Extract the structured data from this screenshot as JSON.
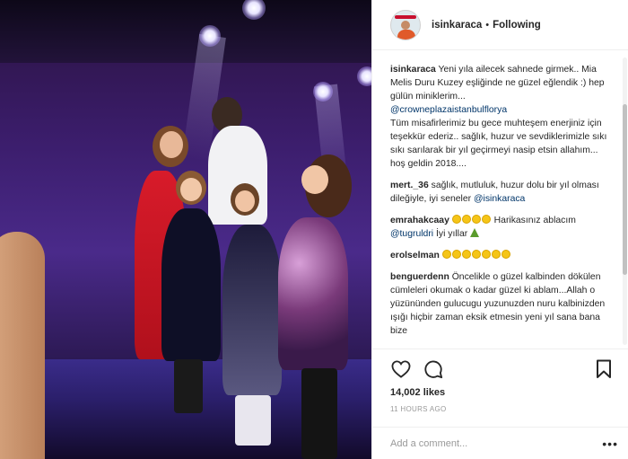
{
  "post": {
    "author": "isinkaraca",
    "follow_status": "Following",
    "separator": "•"
  },
  "comments": [
    {
      "user": "isinkaraca",
      "text": "Yeni yıla ailecek sahnede girmek.. Mia Melis Duru Kuzey eşliğinde ne güzel eğlendik :) hep gülün miniklerim...",
      "mention": "@crowneplazaistanbulflorya",
      "text2": "Tüm misafirlerimiz bu gece muhteşem enerjiniz için teşekkür ederiz.. sağlık, huzur ve sevdiklerimizle sıkı sıkı sarılarak bir yıl geçirmeyi nasip etsin allahım... hoş geldin 2018...."
    },
    {
      "user": "mert._36",
      "text": "sağlık, mutluluk, huzur dolu bir yıl olması dileğiyle, iyi seneler",
      "mention": "@isinkaraca"
    },
    {
      "user": "emrahakcaay",
      "text": "Harikasınız ablacım",
      "mention": "@tugruldri",
      "text2": "İyi yıllar"
    },
    {
      "user": "erolselman"
    },
    {
      "user": "benguerdenn",
      "text": "Öncelikle o güzel kalbinden dökülen cümleleri okumak o kadar güzel ki ablam...Allah o yüzününden gulucugu yuzunuzden nuru kalbinizden ışığı hiçbir zaman eksik etmesin yeni yıl sana bana bize"
    }
  ],
  "actions": {
    "icons": [
      "heart-icon",
      "comment-icon",
      "bookmark-icon"
    ],
    "likes": "14,002 likes",
    "time": "11 HOURS AGO"
  },
  "add_comment": {
    "placeholder": "Add a comment...",
    "more": "•••"
  },
  "colors": {
    "text": "#262626",
    "mention": "#003569",
    "muted": "#999999",
    "border": "#efefef"
  }
}
